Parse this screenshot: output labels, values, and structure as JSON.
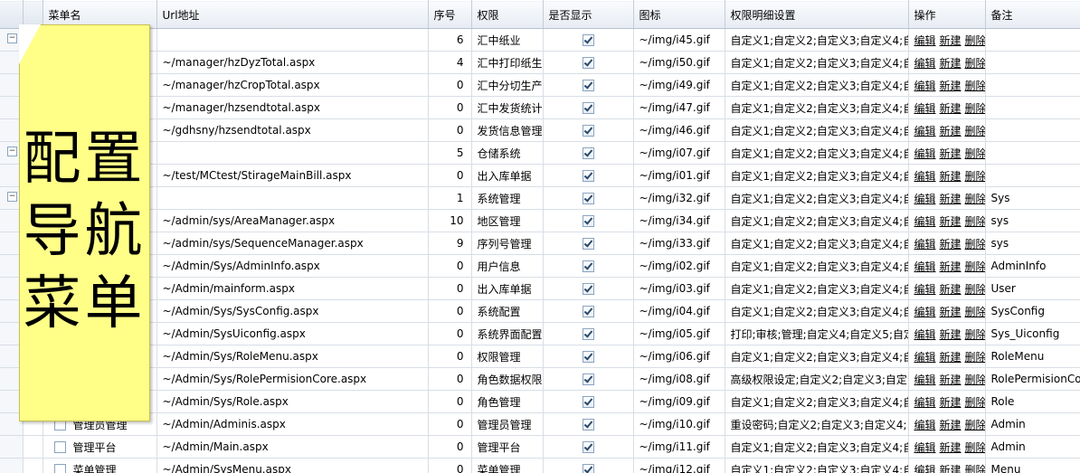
{
  "columns": [
    "菜单名",
    "Url地址",
    "序号",
    "权限",
    "是否显示",
    "图标",
    "权限明细设置",
    "操作",
    "备注"
  ],
  "actions": {
    "edit": "编辑",
    "new": "新建",
    "delete": "删除"
  },
  "rows": [
    {
      "name": "",
      "url": "",
      "order": "6",
      "perm": "汇中纸业",
      "show": true,
      "icon": "~/img/i45.gif",
      "detail": "自定义1;自定义2;自定义3;自定义4;自",
      "remark": ""
    },
    {
      "name": "",
      "url": "~/manager/hzDyzTotal.aspx",
      "order": "4",
      "perm": "汇中打印纸生产",
      "show": true,
      "icon": "~/img/i50.gif",
      "detail": "自定义1;自定义2;自定义3;自定义4;自",
      "remark": ""
    },
    {
      "name": "",
      "url": "~/manager/hzCropTotal.aspx",
      "order": "0",
      "perm": "汇中分切生产统",
      "show": true,
      "icon": "~/img/i49.gif",
      "detail": "自定义1;自定义2;自定义3;自定义4;自",
      "remark": ""
    },
    {
      "name": "",
      "url": "~/manager/hzsendtotal.aspx",
      "order": "0",
      "perm": "汇中发货统计",
      "show": true,
      "icon": "~/img/i47.gif",
      "detail": "自定义1;自定义2;自定义3;自定义4;自",
      "remark": ""
    },
    {
      "name": "",
      "url": "~/gdhsny/hzsendtotal.aspx",
      "order": "0",
      "perm": "发货信息管理",
      "show": true,
      "icon": "~/img/i46.gif",
      "detail": "自定义1;自定义2;自定义3;自定义4;自",
      "remark": ""
    },
    {
      "name": "",
      "url": "",
      "order": "5",
      "perm": "仓储系统",
      "show": true,
      "icon": "~/img/i07.gif",
      "detail": "自定义1;自定义2;自定义3;自定义4;自",
      "remark": ""
    },
    {
      "name": "",
      "url": "~/test/MCtest/StirageMainBill.aspx",
      "order": "0",
      "perm": "出入库单据",
      "show": true,
      "icon": "~/img/i01.gif",
      "detail": "自定义1;自定义2;自定义3;自定义4;自",
      "remark": ""
    },
    {
      "name": "",
      "url": "",
      "order": "1",
      "perm": "系统管理",
      "show": true,
      "icon": "~/img/i32.gif",
      "detail": "自定义1;自定义2;自定义3;自定义4;自",
      "remark": "Sys"
    },
    {
      "name": "",
      "url": "~/admin/sys/AreaManager.aspx",
      "order": "10",
      "perm": "地区管理",
      "show": true,
      "icon": "~/img/i34.gif",
      "detail": "自定义1;自定义2;自定义3;自定义4;自",
      "remark": "sys"
    },
    {
      "name": "",
      "url": "~/admin/sys/SequenceManager.aspx",
      "order": "9",
      "perm": "序列号管理",
      "show": true,
      "icon": "~/img/i33.gif",
      "detail": "自定义1;自定义2;自定义3;自定义4;自",
      "remark": "sys"
    },
    {
      "name": "",
      "url": "~/Admin/Sys/AdminInfo.aspx",
      "order": "0",
      "perm": "用户信息",
      "show": true,
      "icon": "~/img/i02.gif",
      "detail": "自定义1;自定义2;自定义3;自定义4;自",
      "remark": "AdminInfo"
    },
    {
      "name": "",
      "url": "~/Admin/mainform.aspx",
      "order": "0",
      "perm": "出入库单据",
      "show": true,
      "icon": "~/img/i03.gif",
      "detail": "自定义1;自定义2;自定义3;自定义4;自",
      "remark": "User"
    },
    {
      "name": "",
      "url": "~/Admin/Sys/SysConfig.aspx",
      "order": "0",
      "perm": "系统配置",
      "show": true,
      "icon": "~/img/i04.gif",
      "detail": "自定义1;自定义2;自定义3;自定义4;自",
      "remark": "SysConfig"
    },
    {
      "name": "",
      "url": "~/Admin/SysUiconfig.aspx",
      "order": "0",
      "perm": "系统界面配置",
      "show": true,
      "icon": "~/img/i05.gif",
      "detail": "打印;审核;管理;自定义4;自定义5;自定",
      "remark": "Sys_Uiconfig"
    },
    {
      "name": "",
      "url": "~/Admin/Sys/RoleMenu.aspx",
      "order": "0",
      "perm": "权限管理",
      "show": true,
      "icon": "~/img/i06.gif",
      "detail": "自定义1;自定义2;自定义3;自定义4;自",
      "remark": "RoleMenu"
    },
    {
      "name": "",
      "url": "~/Admin/Sys/RolePermisionCore.aspx",
      "order": "0",
      "perm": "角色数据权限",
      "show": true,
      "icon": "~/img/i08.gif",
      "detail": "高级权限设定;自定义2;自定义3;自定",
      "remark": "RolePermisionCor"
    },
    {
      "name": "",
      "url": "~/Admin/Sys/Role.aspx",
      "order": "0",
      "perm": "角色管理",
      "show": true,
      "icon": "~/img/i09.gif",
      "detail": "自定义1;自定义2;自定义3;自定义4;自",
      "remark": "Role"
    },
    {
      "name": "管理员管理",
      "url": "~/Admin/Adminis.aspx",
      "order": "0",
      "perm": "管理员管理",
      "show": true,
      "icon": "~/img/i10.gif",
      "detail": "重设密码;自定义2;自定义3;自定义4;自",
      "remark": "Admin"
    },
    {
      "name": "管理平台",
      "url": "~/Admin/Main.aspx",
      "order": "0",
      "perm": "管理平台",
      "show": true,
      "icon": "~/img/i11.gif",
      "detail": "自定义1;自定义2;自定义3;自定义4;自",
      "remark": "Admin"
    },
    {
      "name": "菜单管理",
      "url": "~/Admin/SysMenu.aspx",
      "order": "0",
      "perm": "菜单管理",
      "show": true,
      "icon": "~/img/i12.gif",
      "detail": "自定义1;自定义2;自定义3;自定义4;自",
      "remark": "Menu"
    }
  ],
  "note_lines": [
    "配置",
    "导航",
    "菜单"
  ],
  "colors": {
    "note_bg": "#ffff88",
    "header_bg": "#e7ecf3",
    "grid_line": "#d8dee6"
  }
}
